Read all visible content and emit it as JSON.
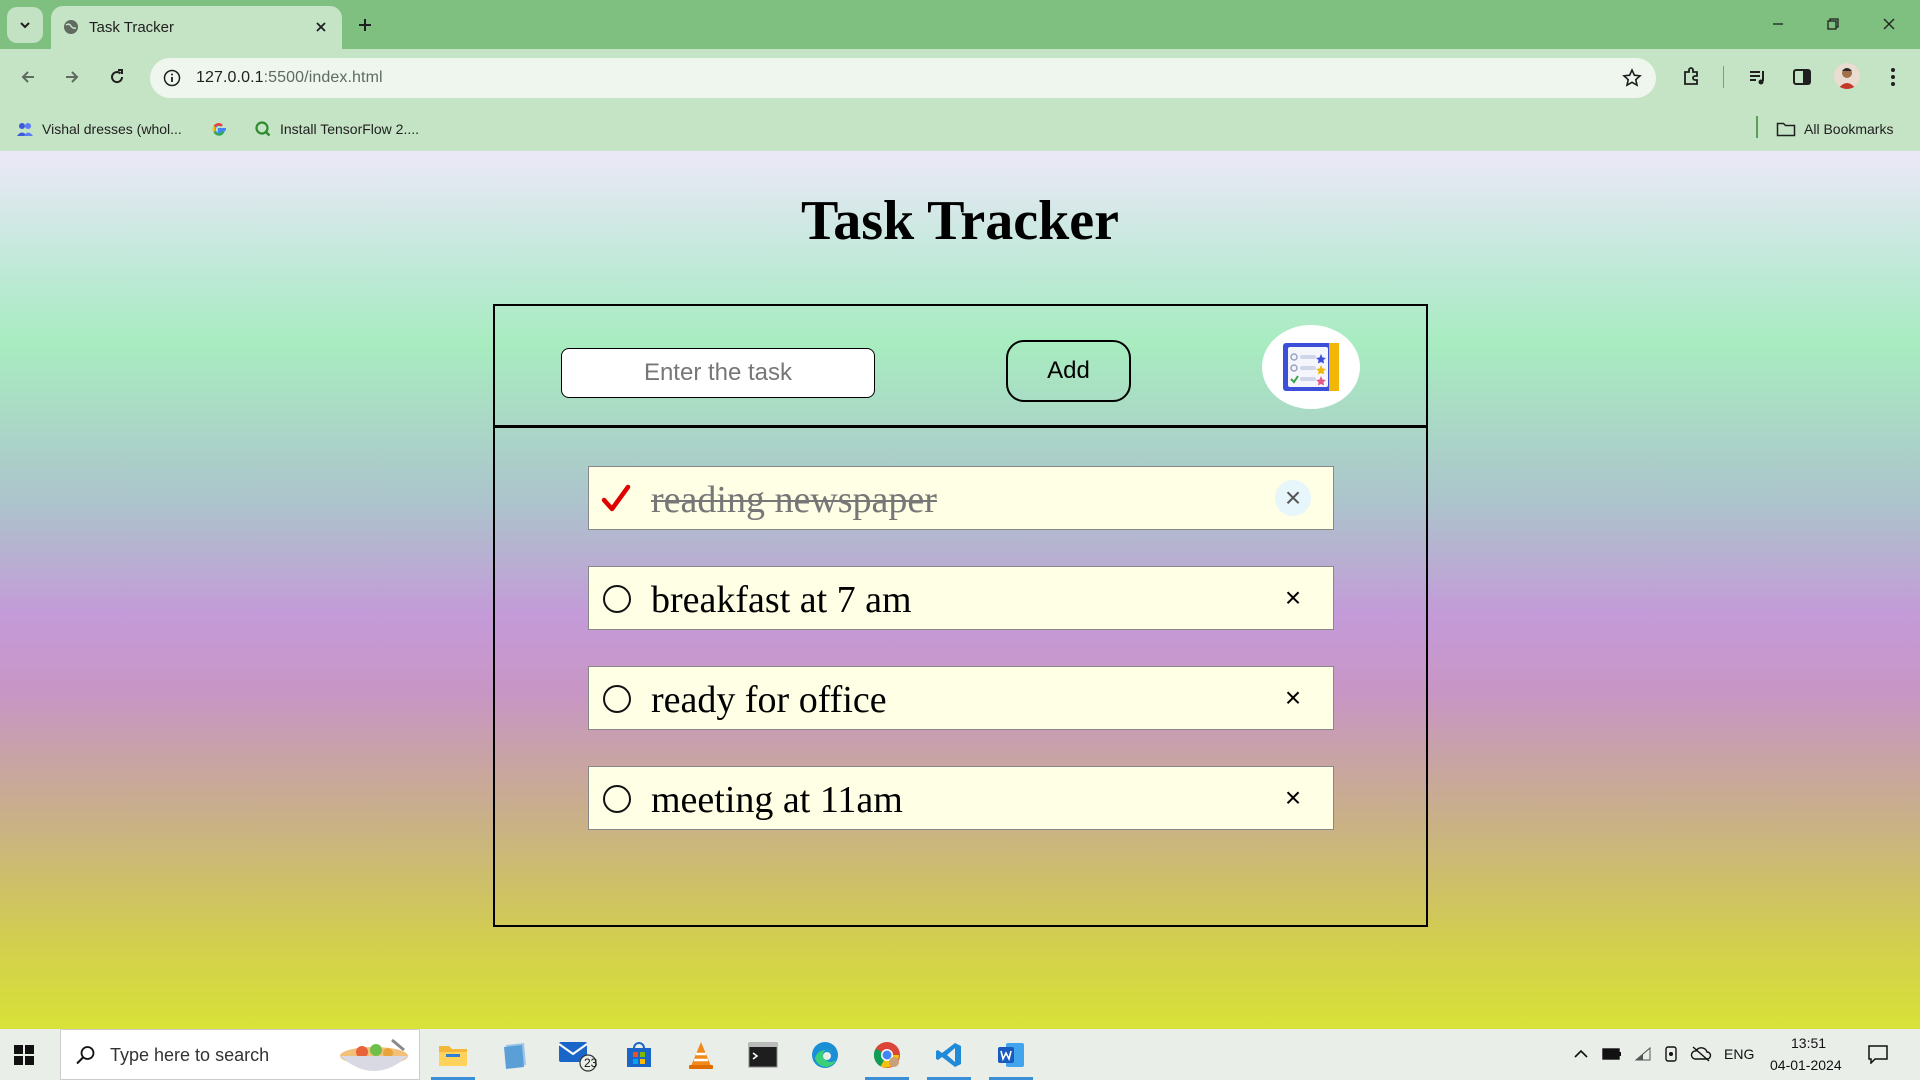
{
  "browser": {
    "tab_title": "Task Tracker",
    "url_host": "127.0.0.1",
    "url_rest": ":5500/index.html",
    "bookmarks": [
      "Vishal dresses (whol...",
      "Install TensorFlow 2...."
    ],
    "all_bookmarks_label": "All Bookmarks"
  },
  "app": {
    "title": "Task Tracker",
    "input_placeholder": "Enter the task",
    "add_label": "Add",
    "delete_symbol": "×",
    "tasks": [
      {
        "text": "reading newspaper",
        "done": true
      },
      {
        "text": "breakfast at 7 am",
        "done": false
      },
      {
        "text": "ready for office",
        "done": false
      },
      {
        "text": "meeting at 11am",
        "done": false
      }
    ]
  },
  "taskbar": {
    "search_placeholder": "Type here to search",
    "mail_badge": "23",
    "language": "ENG",
    "time": "13:51",
    "date": "04-01-2024"
  },
  "colors": {
    "check_red": "#e00000",
    "task_bg": "#ffffe6"
  }
}
